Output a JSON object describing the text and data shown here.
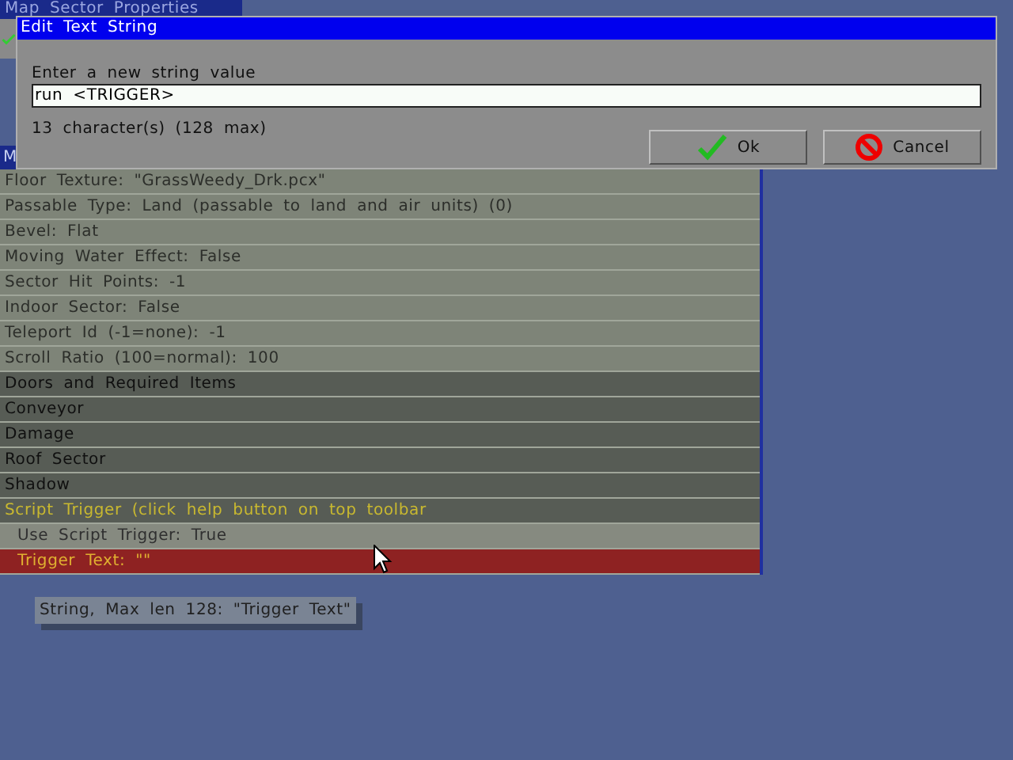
{
  "background_window": {
    "title": "Map Sector Properties",
    "section_header": "M"
  },
  "properties": [
    {
      "kind": "property",
      "label": "Floor Texture: \"GrassWeedy_Drk.pcx\"",
      "selected": false
    },
    {
      "kind": "property",
      "label": "Passable Type: Land (passable to land and air units) (0)",
      "selected": false
    },
    {
      "kind": "property",
      "label": "Bevel: Flat",
      "selected": false
    },
    {
      "kind": "property",
      "label": "Moving Water Effect: False",
      "selected": false
    },
    {
      "kind": "property",
      "label": "Sector Hit Points: -1",
      "selected": false
    },
    {
      "kind": "property",
      "label": "Indoor Sector: False",
      "selected": false
    },
    {
      "kind": "property",
      "label": "Teleport Id (-1=none): -1",
      "selected": false
    },
    {
      "kind": "property",
      "label": "Scroll Ratio (100=normal): 100",
      "selected": false
    },
    {
      "kind": "category",
      "label": "Doors and Required Items",
      "selected": false
    },
    {
      "kind": "category",
      "label": "Conveyor",
      "selected": false
    },
    {
      "kind": "category",
      "label": "Damage",
      "selected": false
    },
    {
      "kind": "category",
      "label": "Roof Sector",
      "selected": false
    },
    {
      "kind": "category",
      "label": "Shadow",
      "selected": false
    },
    {
      "kind": "active_category",
      "label": "Script Trigger (click help button on top toolbar",
      "selected": false
    },
    {
      "kind": "subproperty",
      "label": "Use Script Trigger: True",
      "selected": false
    },
    {
      "kind": "subproperty",
      "label": "Trigger Text: \"\"",
      "selected": true
    }
  ],
  "tooltip": "String, Max len 128: \"Trigger Text\"",
  "dialog": {
    "title": "Edit Text String",
    "prompt": "Enter a new string value",
    "value": "run <TRIGGER>",
    "count": "13 character(s) (128 max)",
    "buttons": [
      {
        "kind": "ok",
        "label": "Ok"
      },
      {
        "kind": "cancel",
        "label": "Cancel"
      }
    ]
  }
}
